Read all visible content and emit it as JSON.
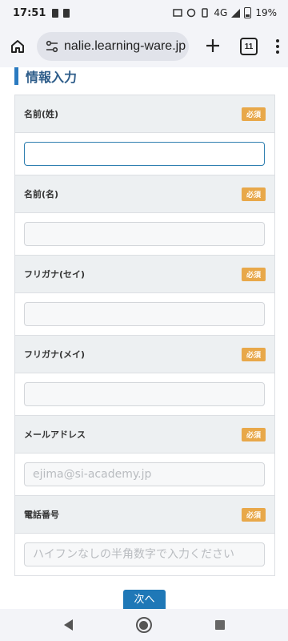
{
  "status_bar": {
    "time": "17:51",
    "network": "4G",
    "battery": "19%",
    "icons": [
      "notification-icon",
      "notification-icon",
      "cast-icon",
      "hotspot-icon",
      "vibrate-icon",
      "signal-icon",
      "battery-icon"
    ]
  },
  "browser": {
    "url": "nalie.learning-ware.jp",
    "tab_count": "11"
  },
  "section": {
    "title": "情報入力"
  },
  "form": {
    "required_label": "必須",
    "fields": [
      {
        "label": "名前(姓)",
        "value": "",
        "placeholder": ""
      },
      {
        "label": "名前(名)",
        "value": "",
        "placeholder": ""
      },
      {
        "label": "フリガナ(セイ)",
        "value": "",
        "placeholder": ""
      },
      {
        "label": "フリガナ(メイ)",
        "value": "",
        "placeholder": ""
      },
      {
        "label": "メールアドレス",
        "value": "",
        "placeholder": "ejima@si-academy.jp"
      },
      {
        "label": "電話番号",
        "value": "",
        "placeholder": "ハイフンなしの半角数字で入力ください"
      }
    ]
  },
  "next_button": "次へ",
  "colors": {
    "accent": "#1f78b7",
    "badge": "#e8a84a",
    "title": "#2e5d8a"
  }
}
